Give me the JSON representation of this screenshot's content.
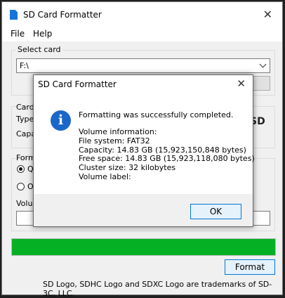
{
  "window": {
    "title": "SD Card Formatter",
    "icon": "sd-card-icon"
  },
  "menu": {
    "file": "File",
    "help": "Help"
  },
  "select_card": {
    "label": "Select card",
    "value": "F:\\"
  },
  "card_info": {
    "group_label": "Card",
    "type_label": "Type",
    "capacity_label": "Capa"
  },
  "format_options": {
    "group_label": "Form",
    "quick_label": "Q",
    "overwrite_label": "O",
    "volume_label": "Volu"
  },
  "progress": {
    "fraction": 1.0,
    "color": "#06b025"
  },
  "format_button": "Format",
  "footer": "SD Logo, SDHC Logo and SDXC Logo are trademarks of SD-3C, LLC.",
  "sd_logo": "SD",
  "dialog": {
    "title": "SD Card Formatter",
    "icon": "info-icon",
    "message": "Formatting was successfully completed.",
    "lines": [
      "Volume information:",
      "File system: FAT32",
      "Capacity: 14.83 GB (15,923,150,848 bytes)",
      "Free space: 14.83 GB (15,923,118,080 bytes)",
      "Cluster size: 32 kilobytes",
      "Volume label:"
    ],
    "ok_label": "OK"
  }
}
